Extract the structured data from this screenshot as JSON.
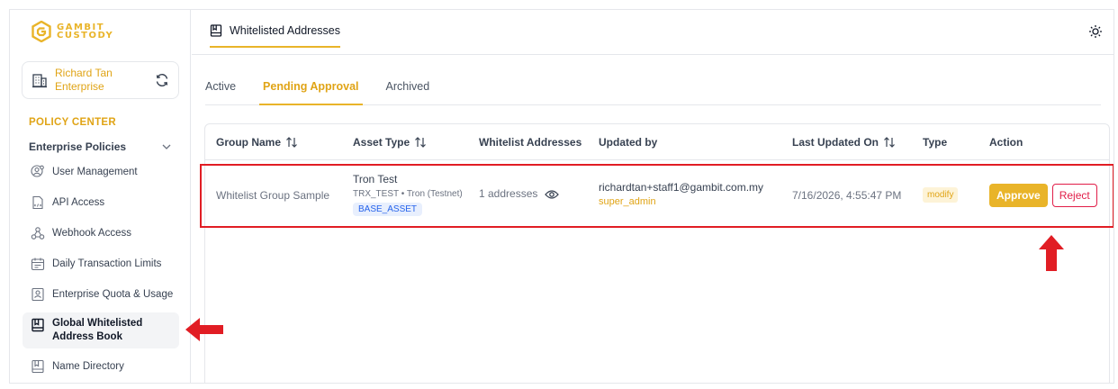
{
  "brand": {
    "line1": "GAMBIT",
    "line2": "CUSTODY",
    "color": "#e9b429"
  },
  "enterprise": {
    "name_line1": "Richard Tan",
    "name_line2": "Enterprise"
  },
  "sidebar": {
    "section_title": "POLICY CENTER",
    "group_title": "Enterprise Policies",
    "items": [
      {
        "label": "User Management",
        "icon": "user-gear-icon"
      },
      {
        "label": "API Access",
        "icon": "api-file-icon"
      },
      {
        "label": "Webhook Access",
        "icon": "webhook-icon"
      },
      {
        "label": "Daily Transaction Limits",
        "icon": "calendar-icon"
      },
      {
        "label": "Enterprise Quota & Usage",
        "icon": "quota-icon"
      },
      {
        "label": "Global Whitelisted Address Book",
        "icon": "address-book-icon",
        "active": true
      },
      {
        "label": "Name Directory",
        "icon": "directory-icon"
      }
    ]
  },
  "header": {
    "page_tab": "Whitelisted Addresses"
  },
  "tabs": [
    {
      "label": "Active"
    },
    {
      "label": "Pending Approval",
      "active": true
    },
    {
      "label": "Archived"
    }
  ],
  "table": {
    "columns": [
      "Group Name",
      "Asset Type",
      "Whitelist Addresses",
      "Updated by",
      "Last Updated On",
      "Type",
      "Action"
    ],
    "rows": [
      {
        "group_name": "Whitelist Group Sample",
        "asset_title": "Tron Test",
        "asset_sub": "TRX_TEST • Tron (Testnet)",
        "asset_chip": "BASE_ASSET",
        "addresses": "1 addresses",
        "updated_by_email": "richardtan+staff1@gambit.com.my",
        "updated_by_role": "super_admin",
        "last_updated": "7/16/2026, 4:55:47 PM",
        "type": "modify",
        "approve_label": "Approve",
        "reject_label": "Reject"
      }
    ]
  },
  "colors": {
    "accent": "#e9b429",
    "highlight": "#e11d24",
    "reject": "#e11d48"
  }
}
